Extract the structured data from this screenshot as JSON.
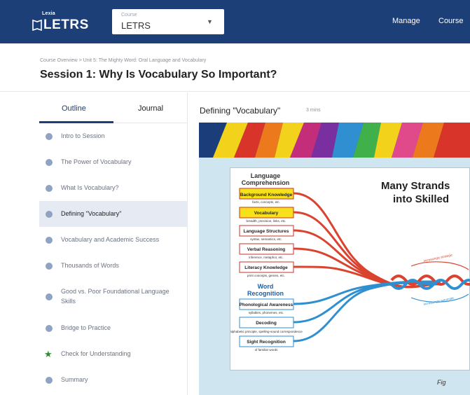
{
  "header": {
    "logo_small": "Lexia",
    "logo_main": "LETRS",
    "course_select": {
      "label": "Course",
      "value": "LETRS"
    },
    "nav": [
      "Manage",
      "Course"
    ]
  },
  "breadcrumb": "Course Overview > Unit 5: The Mighty Word: Oral Language and Vocabulary",
  "page_title": "Session 1:  Why Is Vocabulary So Important?",
  "sidebar": {
    "tabs": [
      "Outline",
      "Journal"
    ],
    "items": [
      {
        "label": "Intro to Session",
        "icon": "dot-icon"
      },
      {
        "label": "The Power of Vocabulary",
        "icon": "dot-icon"
      },
      {
        "label": "What Is Vocabulary?",
        "icon": "dot-icon"
      },
      {
        "label": "Defining \"Vocabulary\"",
        "icon": "dot-icon",
        "active": true
      },
      {
        "label": "Vocabulary and Academic Success",
        "icon": "dot-icon"
      },
      {
        "label": "Thousands of Words",
        "icon": "dot-icon"
      },
      {
        "label": "Good vs. Poor Foundational Language Skills",
        "icon": "dot-icon"
      },
      {
        "label": "Bridge to Practice",
        "icon": "dot-icon"
      },
      {
        "label": "Check for Understanding",
        "icon": "star-icon"
      },
      {
        "label": "Summary",
        "icon": "dot-icon"
      }
    ]
  },
  "content": {
    "title": "Defining \"Vocabulary\"",
    "duration": "3 mins",
    "slide": {
      "heading_line1": "Many Strands",
      "heading_line2": "into Skilled",
      "language_comprehension_title": "Language Comprehension",
      "language_strands": [
        {
          "label": "Background Knowledge",
          "sub": "facts, concepts, etc."
        },
        {
          "label": "Vocabulary",
          "sub": "breadth, precision, links, etc."
        },
        {
          "label": "Language Structures",
          "sub": "syntax, semantics, etc."
        },
        {
          "label": "Verbal Reasoning",
          "sub": "inference, metaphor, etc."
        },
        {
          "label": "Literacy Knowledge",
          "sub": "print concepts, genres, etc."
        }
      ],
      "word_recognition_title": "Word Recognition",
      "word_strands": [
        {
          "label": "Phonological Awareness",
          "sub": "syllables, phonemes, etc."
        },
        {
          "label": "Decoding",
          "sub": "alphabetic principle, spelling-sound correspondence"
        },
        {
          "label": "Sight Recognition",
          "sub": "of familiar words"
        }
      ],
      "arrow_text_top": "increasingly strategic",
      "arrow_text_bottom": "increasingly automatic",
      "caption": "Fig"
    }
  },
  "colors": {
    "nav_bg": "#1d3f77",
    "active_item_bg": "#e6ebf3",
    "dot": "#8fa3c2",
    "star": "#2e8b2e",
    "language_rope": "#d9432f",
    "word_rope": "#2f8fd0",
    "highlight_box": "#f7e11b"
  }
}
